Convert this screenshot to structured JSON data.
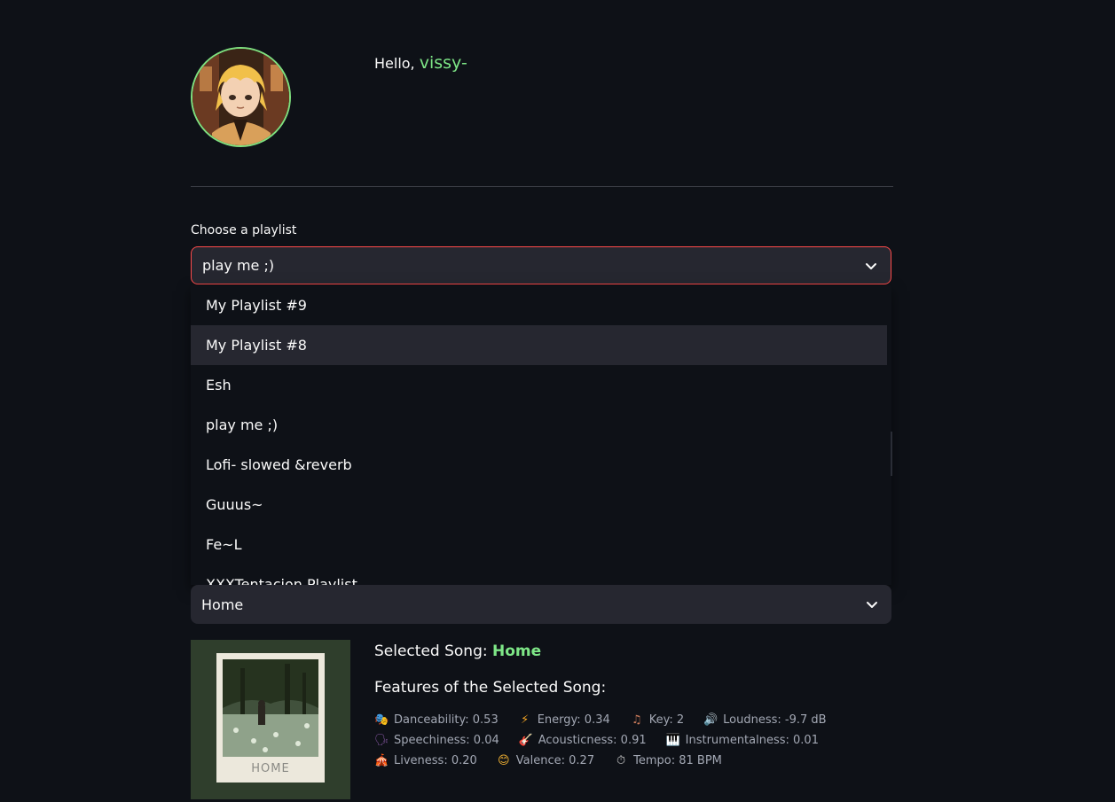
{
  "header": {
    "greeting": "Hello,",
    "username": "vissy-"
  },
  "playlist": {
    "label": "Choose a playlist",
    "selected": "play me ;)",
    "options": [
      "My Playlist #9",
      "My Playlist #8",
      "Esh",
      "play me ;)",
      "Lofi- slowed &reverb",
      "Guuus~",
      "Fe~L",
      "XXXTentacion Playlist"
    ],
    "highlighted_index": 1
  },
  "song_select": {
    "selected": "Home"
  },
  "cover": {
    "text": "HOME"
  },
  "song": {
    "selected_prefix": "Selected Song:",
    "selected_name": "Home",
    "features_title": "Features of the Selected Song:",
    "features": [
      {
        "icon": "theater-masks-icon",
        "glyph": "🎭",
        "color": "#e8a23a",
        "text": "Danceability: 0.53"
      },
      {
        "icon": "lightning-icon",
        "glyph": "⚡",
        "color": "#f5a623",
        "text": "Energy: 0.34"
      },
      {
        "icon": "music-note-icon",
        "glyph": "♫",
        "color": "#c97a5a",
        "text": "Key: 2"
      },
      {
        "icon": "speaker-icon",
        "glyph": "🔊",
        "color": "#9ab0c8",
        "text": "Loudness: -9.7 dB"
      },
      {
        "icon": "speaking-head-icon",
        "glyph": "🗣",
        "color": "#8a5aa8",
        "text": "Speechiness: 0.04"
      },
      {
        "icon": "guitar-icon",
        "glyph": "🎸",
        "color": "#d0486a",
        "text": "Acousticness: 0.91"
      },
      {
        "icon": "piano-icon",
        "glyph": "🎹",
        "color": "#d8d8d8",
        "text": "Instrumentalness: 0.01"
      },
      {
        "icon": "circus-tent-icon",
        "glyph": "🎪",
        "color": "#e85a6a",
        "text": "Liveness: 0.20"
      },
      {
        "icon": "smiley-icon",
        "glyph": "😊",
        "color": "#f2b233",
        "text": "Valence: 0.27"
      },
      {
        "icon": "stopwatch-icon",
        "glyph": "⏱",
        "color": "#cfcfcf",
        "text": "Tempo: 81 BPM"
      }
    ]
  },
  "colors": {
    "background": "#0e1117",
    "accent_green": "#7ee787",
    "focus_red": "#ff4b4b",
    "select_bg": "#262730"
  }
}
